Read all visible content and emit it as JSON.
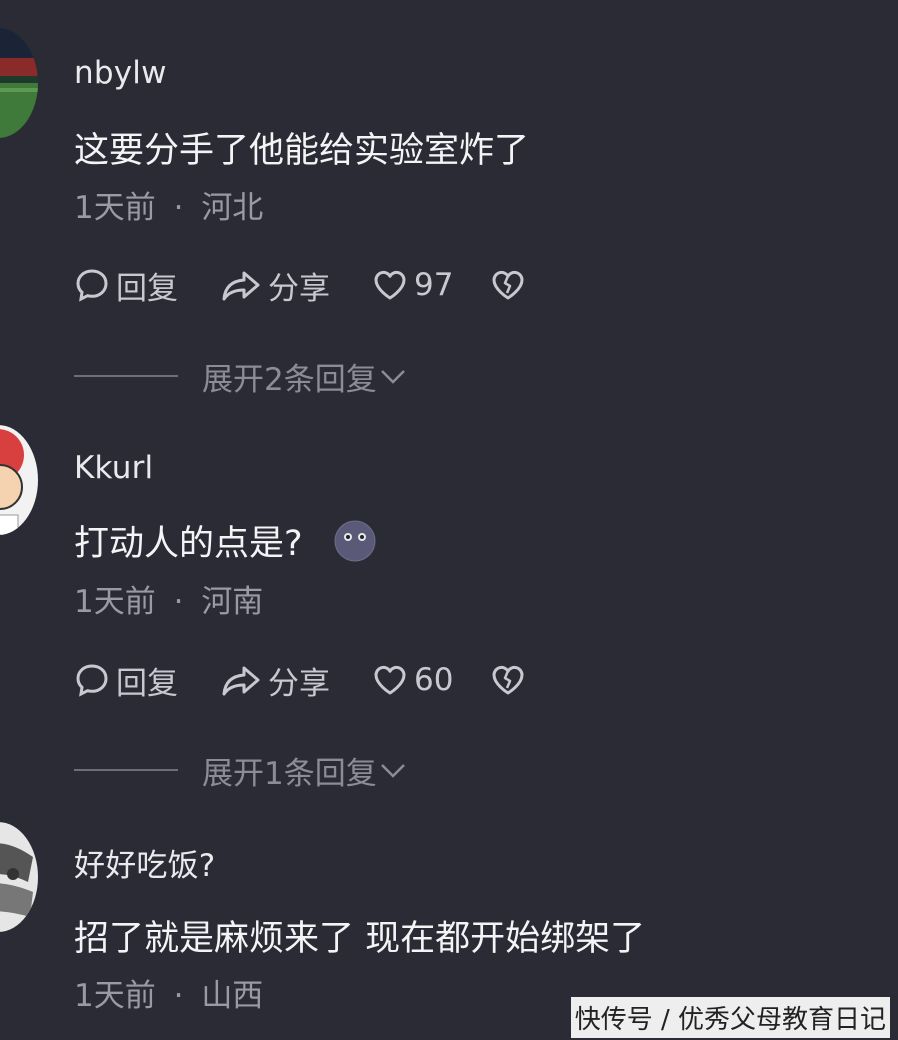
{
  "comments": [
    {
      "username": "nbylw",
      "text": "这要分手了他能给实验室炸了",
      "time": "1天前",
      "location": "河北",
      "reply_label": "回复",
      "share_label": "分享",
      "likes": "97",
      "expand_label": "展开2条回复"
    },
    {
      "username": "Kkurl",
      "text": "打动人的点是?",
      "time": "1天前",
      "location": "河南",
      "reply_label": "回复",
      "share_label": "分享",
      "likes": "60",
      "expand_label": "展开1条回复"
    },
    {
      "username": "好好吃饭?",
      "text": "招了就是麻烦来了 现在都开始绑架了",
      "time": "1天前",
      "location": "山西"
    }
  ],
  "meta_separator": "·",
  "watermark": "快传号 / 优秀父母教育日记",
  "colors": {
    "background": "#2b2b35",
    "primary_text": "#f4f4f6",
    "secondary_text": "#9a9aa4"
  },
  "icons": [
    "comment-bubble-icon",
    "share-arrow-icon",
    "heart-icon",
    "broken-heart-icon",
    "chevron-down-icon",
    "smiling-face-emoji"
  ]
}
